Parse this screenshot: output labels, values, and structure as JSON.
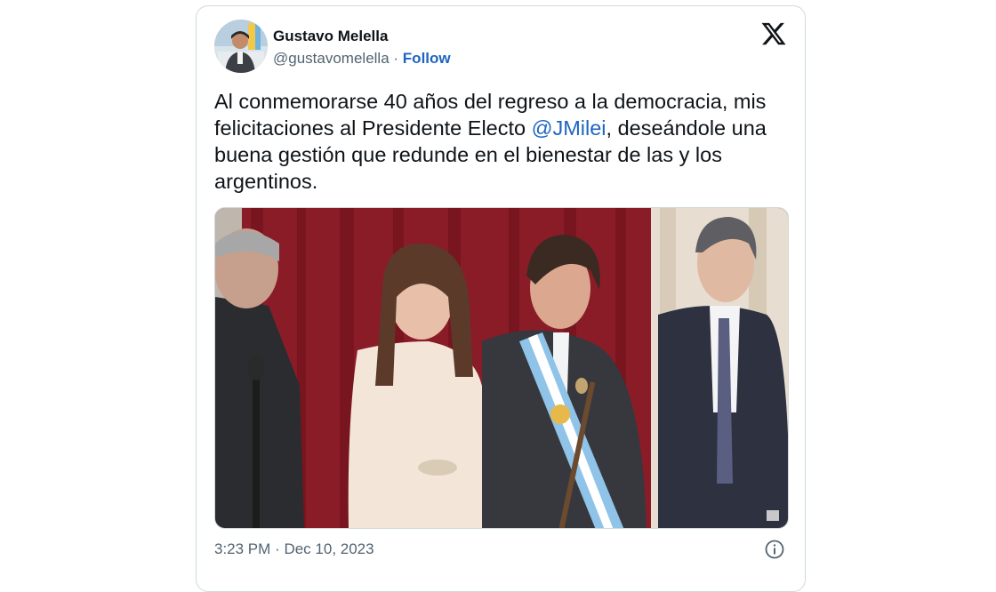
{
  "author": {
    "name": "Gustavo Melella",
    "handle": "@gustavomelella",
    "separator": "·",
    "follow_label": "Follow"
  },
  "tweet": {
    "text_before": "Al conmemorarse  40 años del regreso a la democracia, mis felicitaciones al Presidente Electo ",
    "mention": "@JMilei",
    "text_after": ", deseándole una buena gestión que redunde en el bienestar de las y los argentinos."
  },
  "footer": {
    "time": "3:23 PM",
    "separator": "·",
    "date": "Dec 10, 2023"
  },
  "icons": {
    "x_logo": "x-logo-icon",
    "info": "info-icon"
  },
  "colors": {
    "link": "#1d65c1",
    "secondary_text": "#536471",
    "border": "#cfd9de",
    "curtain": "#7a1622",
    "sash_blue": "#8fc3e8"
  }
}
